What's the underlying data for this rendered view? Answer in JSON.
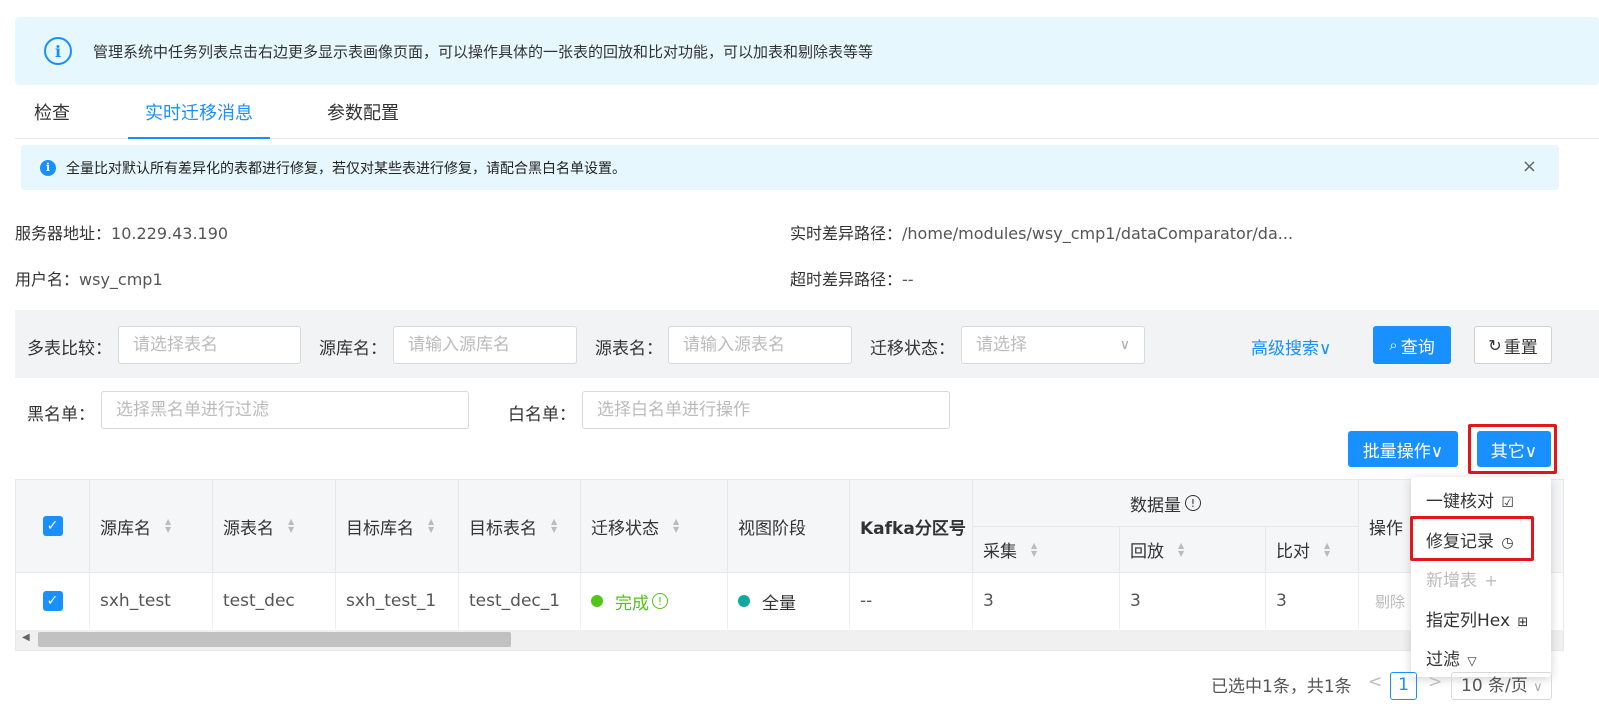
{
  "top_info": {
    "text": "管理系统中任务列表点击右边更多显示表画像页面，可以操作具体的一张表的回放和比对功能，可以加表和剔除表等等"
  },
  "tabs": [
    {
      "label": "检查"
    },
    {
      "label": "实时迁移消息",
      "active": true
    },
    {
      "label": "参数配置"
    }
  ],
  "alert": {
    "text": "全量比对默认所有差异化的表都进行修复，若仅对某些表进行修复，请配合黑白名单设置。",
    "close": "×"
  },
  "meta": {
    "server_label": "服务器地址：",
    "server_value": "10.229.43.190",
    "diff_path_label": "实时差异路径：",
    "diff_path_value": "/home/modules/wsy_cmp1/dataComparator/da...",
    "user_label": "用户名：",
    "user_value": "wsy_cmp1",
    "timeout_path_label": "超时差异路径：",
    "timeout_path_value": "--"
  },
  "filters": {
    "multi_label": "多表比较：",
    "multi_placeholder": "请选择表名",
    "src_db_label": "源库名：",
    "src_db_placeholder": "请输入源库名",
    "src_table_label": "源表名：",
    "src_table_placeholder": "请输入源表名",
    "status_label": "迁移状态：",
    "status_placeholder": "请选择",
    "advanced": "高级搜索∨",
    "query": "查询",
    "reset": "重置",
    "blacklist_label": "黑名单：",
    "blacklist_placeholder": "选择黑名单进行过滤",
    "whitelist_label": "白名单：",
    "whitelist_placeholder": "选择白名单进行操作"
  },
  "actions": {
    "batch": "批量操作∨",
    "other": "其它∨"
  },
  "table": {
    "headers": {
      "src_db": "源库名",
      "src_table": "源表名",
      "tgt_db": "目标库名",
      "tgt_table": "目标表名",
      "status": "迁移状态",
      "view_stage": "视图阶段",
      "kafka": "Kafka分区号",
      "data_volume": "数据量",
      "collect": "采集",
      "replay": "回放",
      "compare": "比对",
      "ops": "操作"
    },
    "rows": [
      {
        "src_db": "sxh_test",
        "src_table": "test_dec",
        "tgt_db": "sxh_test_1",
        "tgt_table": "test_dec_1",
        "status": "完成",
        "view_stage": "全量",
        "kafka": "--",
        "collect": "3",
        "replay": "3",
        "compare": "3",
        "ops": "剔除"
      }
    ]
  },
  "dropdown": {
    "items": [
      {
        "label": "一键核对",
        "icon": "☑"
      },
      {
        "label": "修复记录",
        "icon": "◷"
      },
      {
        "label": "新增表",
        "icon": "+",
        "disabled": true
      },
      {
        "label": "指定列Hex",
        "icon": "⊞"
      },
      {
        "label": "过滤",
        "icon": "▽"
      }
    ]
  },
  "pagination": {
    "summary": "已选中1条，共1条",
    "prev": "<",
    "page": "1",
    "next": ">",
    "page_size": "10 条/页"
  },
  "colors": {
    "primary": "#1890ff",
    "success": "#52c41a",
    "teal": "#13a89e",
    "highlight": "#e1171c"
  }
}
